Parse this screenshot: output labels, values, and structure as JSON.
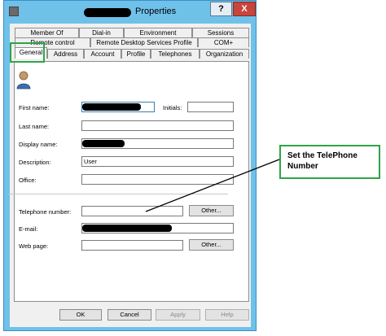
{
  "window": {
    "title": "Properties",
    "help_button": "?",
    "close_button": "X"
  },
  "tabs": {
    "row1": [
      "Member Of",
      "Dial-in",
      "Environment",
      "Sessions"
    ],
    "row2": [
      "Remote control",
      "Remote Desktop Services Profile",
      "COM+"
    ],
    "row3": [
      "General",
      "Address",
      "Account",
      "Profile",
      "Telephones",
      "Organization"
    ],
    "active": "General"
  },
  "form": {
    "first_name_label": "First name:",
    "initials_label": "Initials:",
    "last_name_label": "Last name:",
    "display_name_label": "Display name:",
    "description_label": "Description:",
    "description_value": "User",
    "office_label": "Office:",
    "telephone_label": "Telephone number:",
    "email_label": "E-mail:",
    "webpage_label": "Web page:",
    "other_button": "Other..."
  },
  "footer": {
    "ok": "OK",
    "cancel": "Cancel",
    "apply": "Apply",
    "help": "Help"
  },
  "annotation": {
    "callout_text": "Set the TelePhone Number",
    "highlight_color": "#2ea446"
  }
}
